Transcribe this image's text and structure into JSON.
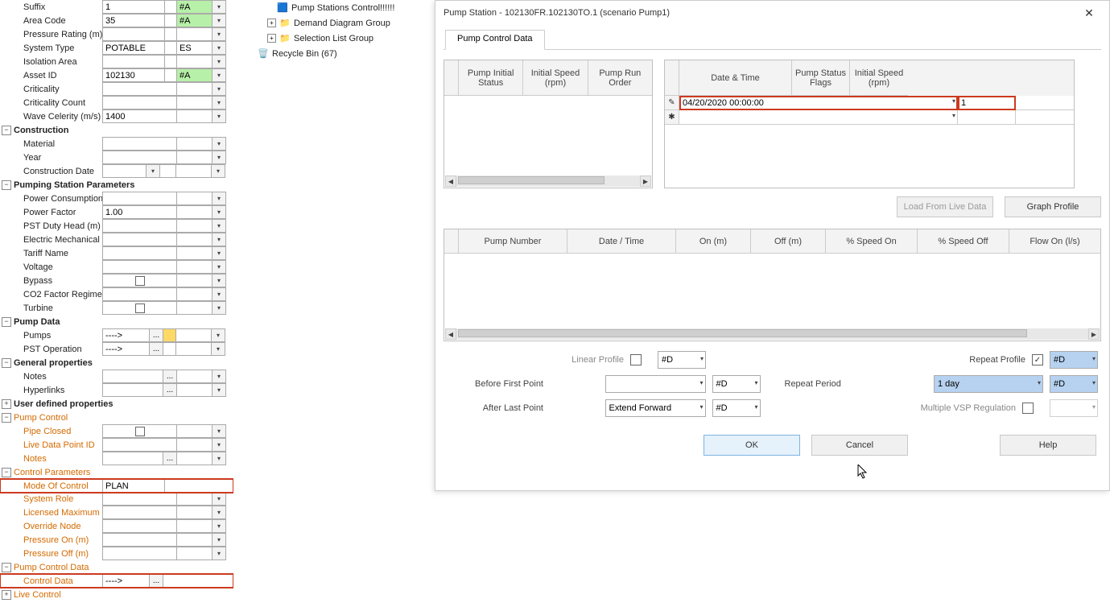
{
  "prop": {
    "suffix_lbl": "Suffix",
    "suffix_val": "1",
    "suffix_flag": "#A",
    "area_lbl": "Area Code",
    "area_val": "35",
    "area_flag": "#A",
    "prate_lbl": "Pressure Rating (m)",
    "systype_lbl": "System Type",
    "systype_val": "POTABLE",
    "systype_flag": "ES",
    "iso_lbl": "Isolation Area",
    "asset_lbl": "Asset ID",
    "asset_val": "102130",
    "asset_flag": "#A",
    "crit_lbl": "Criticality",
    "critc_lbl": "Criticality Count",
    "wave_lbl": "Wave Celerity (m/s)",
    "wave_val": "1400",
    "grp_constr": "Construction",
    "mat_lbl": "Material",
    "year_lbl": "Year",
    "cdate_lbl": "Construction Date",
    "grp_pump_params": "Pumping Station Parameters",
    "pcons_lbl": "Power Consumption",
    "pfact_lbl": "Power Factor",
    "pfact_val": "1.00",
    "pst_lbl": "PST Duty Head (m)",
    "emech_lbl": "Electric Mechanical E",
    "tariff_lbl": "Tariff Name",
    "volt_lbl": "Voltage",
    "bypass_lbl": "Bypass",
    "co2_lbl": "CO2 Factor Regime",
    "turb_lbl": "Turbine",
    "grp_pumpdata": "Pump Data",
    "pumps_lbl": "Pumps",
    "pumps_val": "---->",
    "pstop_lbl": "PST Operation",
    "pstop_val": "---->",
    "grp_gen": "General properties",
    "notes_lbl": "Notes",
    "hyp_lbl": "Hyperlinks",
    "grp_udp": "User defined properties",
    "grp_pumpctrl": "Pump Control",
    "pipe_lbl": "Pipe Closed",
    "live_lbl": "Live Data Point ID",
    "notes2_lbl": "Notes",
    "grp_ctrlparam": "Control Parameters",
    "mode_lbl": "Mode Of Control",
    "mode_val": "PLAN",
    "sysrole_lbl": "System Role",
    "lic_lbl": "Licensed Maximum Po",
    "ovr_lbl": "Override Node",
    "pon_lbl": "Pressure On (m)",
    "poff_lbl": "Pressure Off (m)",
    "grp_pcd": "Pump Control Data",
    "ctrldata_lbl": "Control Data",
    "ctrldata_val": "---->",
    "grp_livectrl": "Live Control"
  },
  "tree": {
    "pump_stations": "Pump Stations Control!!!!!!",
    "demand": "Demand Diagram Group",
    "selection": "Selection List Group",
    "recycle": "Recycle Bin (67)"
  },
  "dlg": {
    "title": "Pump Station - 102130FR.102130TO.1 (scenario Pump1)",
    "tab": "Pump Control Data",
    "left_hdrs": {
      "a": "Pump Initial Status",
      "b": "Initial Speed (rpm)",
      "c": "Pump Run Order"
    },
    "right_hdrs": {
      "a": "Date & Time",
      "b": "Pump Status Flags",
      "c": "Initial Speed (rpm)"
    },
    "row1_dt": "04/20/2020 00:00:00",
    "row1_psf": "1",
    "btn_load": "Load From Live Data",
    "btn_graph": "Graph Profile",
    "wide_hdrs": {
      "a": "Pump Number",
      "b": "Date / Time",
      "c": "On (m)",
      "d": "Off (m)",
      "e": "% Speed On",
      "f": "% Speed Off",
      "g": "Flow On (l/s)"
    },
    "linear_lbl": "Linear Profile",
    "linear_flag": "#D",
    "repeatprof_lbl": "Repeat Profile",
    "repeatprof_flag": "#D",
    "before_lbl": "Before First Point",
    "before_flag": "#D",
    "repeatper_lbl": "Repeat Period",
    "repeatper_val": "1 day",
    "repeatper_flag": "#D",
    "after_lbl": "After Last Point",
    "after_val": "Extend Forward",
    "after_flag": "#D",
    "mvsp_lbl": "Multiple VSP Regulation",
    "ok": "OK",
    "cancel": "Cancel",
    "help": "Help"
  },
  "chevron": "▾",
  "ellipsis": "...",
  "minus": "−",
  "plus": "+",
  "check": "✓",
  "star": "✱",
  "pencil": "✎",
  "left": "◀",
  "right": "▶",
  "x": "✕"
}
